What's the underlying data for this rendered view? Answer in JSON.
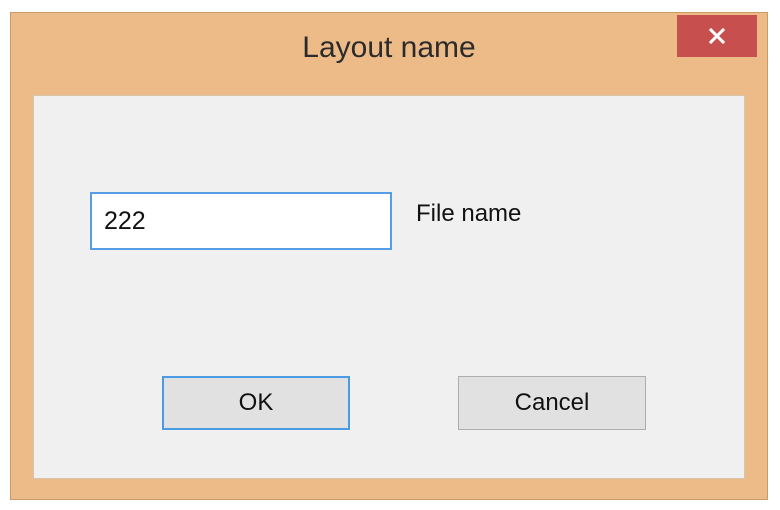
{
  "window": {
    "title": "Layout name",
    "frame_color": "#edbb88",
    "close_button_color": "#c7504f",
    "close_icon": "close-icon"
  },
  "form": {
    "filename_value": "222",
    "filename_label": "File name"
  },
  "buttons": {
    "ok_label": "OK",
    "cancel_label": "Cancel"
  },
  "colors": {
    "focus_border": "#569de5",
    "client_background": "#f0f0f0",
    "button_background": "#e1e1e1"
  }
}
